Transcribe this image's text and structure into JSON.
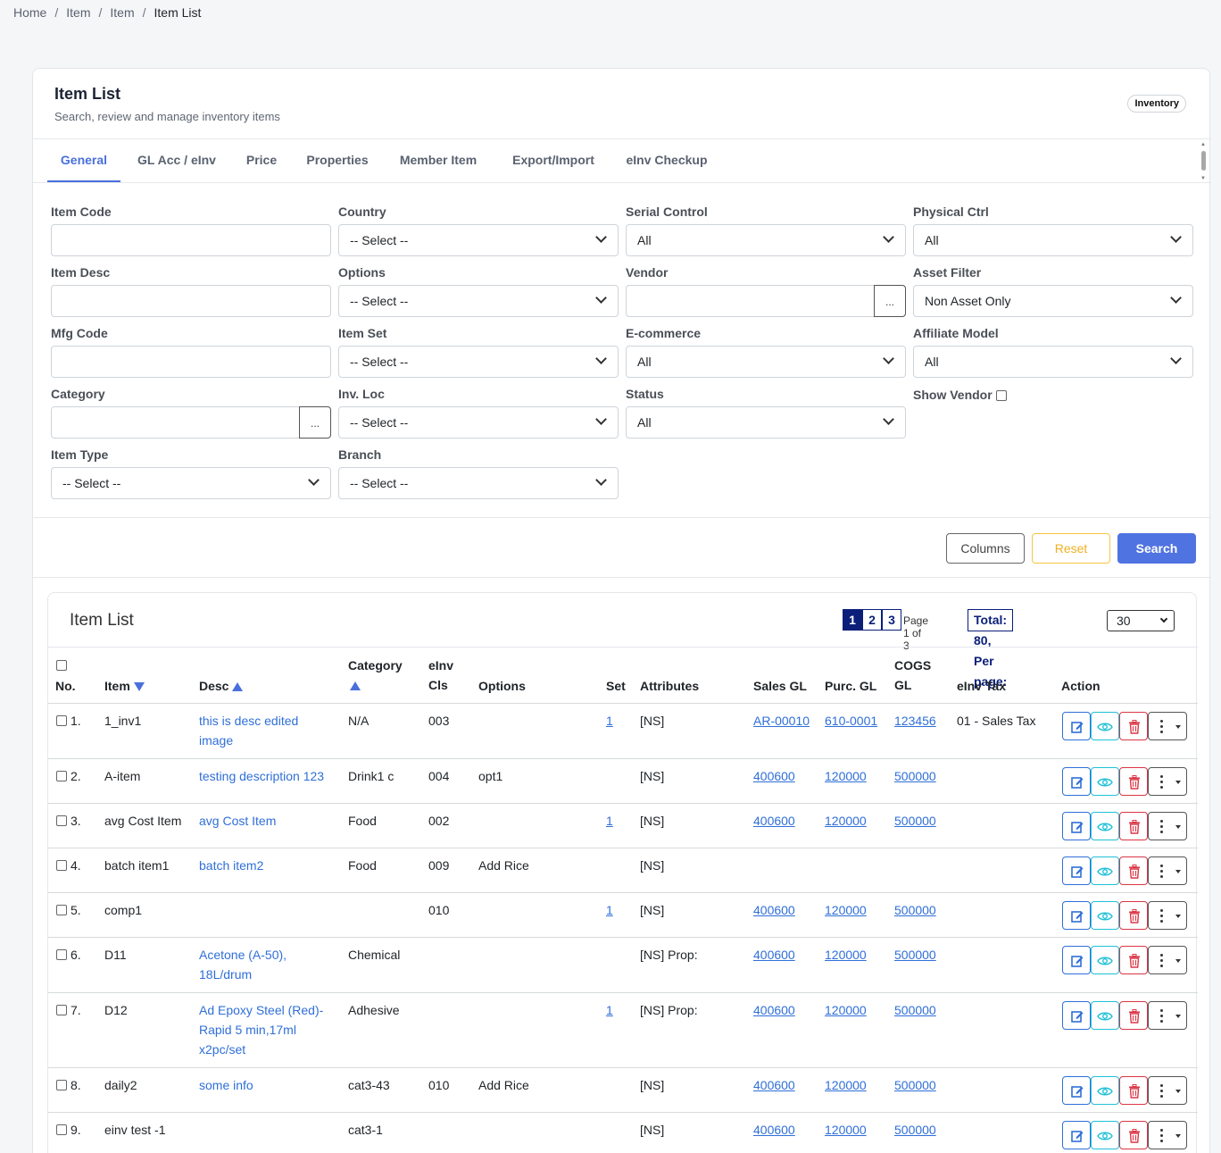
{
  "breadcrumb": [
    "Home",
    "Item",
    "Item",
    "Item List"
  ],
  "header": {
    "title": "Item List",
    "subtitle": "Search, review and manage inventory items",
    "badge": "Inventory"
  },
  "tabs": [
    "General",
    "GL Acc / eInv",
    "Price",
    "Properties",
    "Member Item",
    "Export/Import",
    "eInv Checkup"
  ],
  "active_tab": "General",
  "filters": {
    "item_code": {
      "label": "Item Code",
      "value": ""
    },
    "item_desc": {
      "label": "Item Desc",
      "value": ""
    },
    "mfg_code": {
      "label": "Mfg Code",
      "value": ""
    },
    "category": {
      "label": "Category",
      "value": "",
      "button": "..."
    },
    "item_type": {
      "label": "Item Type",
      "value": "-- Select --"
    },
    "country": {
      "label": "Country",
      "value": "-- Select --"
    },
    "options": {
      "label": "Options",
      "value": "-- Select --"
    },
    "item_set": {
      "label": "Item Set",
      "value": "-- Select --"
    },
    "inv_loc": {
      "label": "Inv. Loc",
      "value": "-- Select --"
    },
    "branch": {
      "label": "Branch",
      "value": "-- Select --"
    },
    "serial_control": {
      "label": "Serial Control",
      "value": "All"
    },
    "vendor": {
      "label": "Vendor",
      "value": "",
      "button": "..."
    },
    "ecommerce": {
      "label": "E-commerce",
      "value": "All"
    },
    "status": {
      "label": "Status",
      "value": "All"
    },
    "physical_ctrl": {
      "label": "Physical Ctrl",
      "value": "All"
    },
    "asset_filter": {
      "label": "Asset Filter",
      "value": "Non Asset Only"
    },
    "affiliate_model": {
      "label": "Affiliate Model",
      "value": "All"
    },
    "show_vendor": {
      "label": "Show Vendor",
      "checked": false
    }
  },
  "buttons": {
    "columns": "Columns",
    "reset": "Reset",
    "search": "Search"
  },
  "list": {
    "title": "Item List",
    "pages": [
      "1",
      "2",
      "3"
    ],
    "active_page": "1",
    "page_info": "Page 1 of 3",
    "total_label": "Total: 80, Per page:",
    "per_page": "30"
  },
  "columns": {
    "no": "No.",
    "item": "Item",
    "desc": "Desc",
    "category": "Category",
    "einv_cls_1": "eInv",
    "einv_cls_2": "Cls",
    "options": "Options",
    "set": "Set",
    "attributes": "Attributes",
    "sales_gl": "Sales GL",
    "purc_gl": "Purc. GL",
    "cogs_gl_1": "COGS",
    "cogs_gl_2": "GL",
    "einv_tax": "eInv Tax",
    "action": "Action"
  },
  "rows": [
    {
      "no": "1.",
      "item": "1_inv1",
      "desc": [
        "this is desc edited",
        "image"
      ],
      "category": "N/A",
      "einv_cls": "003",
      "options": "",
      "set": "1",
      "attributes": "[NS]",
      "sales_gl": "AR-00010",
      "purc_gl": "610-0001",
      "cogs_gl": "123456",
      "einv_tax": "01 - Sales Tax"
    },
    {
      "no": "2.",
      "item": "A-item",
      "desc": [
        "testing description 123"
      ],
      "category": "Drink1 c",
      "einv_cls": "004",
      "options": "opt1",
      "set": "",
      "attributes": "[NS]",
      "sales_gl": "400600",
      "purc_gl": "120000",
      "cogs_gl": "500000",
      "einv_tax": ""
    },
    {
      "no": "3.",
      "item": "avg Cost Item",
      "desc": [
        "avg Cost Item"
      ],
      "category": "Food",
      "einv_cls": "002",
      "options": "",
      "set": "1",
      "attributes": "[NS]",
      "sales_gl": "400600",
      "purc_gl": "120000",
      "cogs_gl": "500000",
      "einv_tax": ""
    },
    {
      "no": "4.",
      "item": "batch item1",
      "desc": [
        "batch item2"
      ],
      "category": "Food",
      "einv_cls": "009",
      "options": "Add Rice",
      "set": "",
      "attributes": "[NS]",
      "sales_gl": "",
      "purc_gl": "",
      "cogs_gl": "",
      "einv_tax": ""
    },
    {
      "no": "5.",
      "item": "comp1",
      "desc": [
        ""
      ],
      "category": "",
      "einv_cls": "010",
      "options": "",
      "set": "1",
      "attributes": "[NS]",
      "sales_gl": "400600",
      "purc_gl": "120000",
      "cogs_gl": "500000",
      "einv_tax": ""
    },
    {
      "no": "6.",
      "item": "D11",
      "desc": [
        "Acetone (A-50),",
        "18L/drum"
      ],
      "category": "Chemical",
      "einv_cls": "",
      "options": "",
      "set": "",
      "attributes": "[NS] Prop:",
      "sales_gl": "400600",
      "purc_gl": "120000",
      "cogs_gl": "500000",
      "einv_tax": ""
    },
    {
      "no": "7.",
      "item": "D12",
      "desc": [
        "Ad Epoxy Steel (Red)-",
        "Rapid 5 min,17ml",
        "x2pc/set"
      ],
      "category": "Adhesive",
      "einv_cls": "",
      "options": "",
      "set": "1",
      "attributes": "[NS] Prop:",
      "sales_gl": "400600",
      "purc_gl": "120000",
      "cogs_gl": "500000",
      "einv_tax": ""
    },
    {
      "no": "8.",
      "item": "daily2",
      "desc": [
        "some info"
      ],
      "category": "cat3-43",
      "einv_cls": "010",
      "options": "Add Rice",
      "set": "",
      "attributes": "[NS]",
      "sales_gl": "400600",
      "purc_gl": "120000",
      "cogs_gl": "500000",
      "einv_tax": ""
    },
    {
      "no": "9.",
      "item": "einv test -1",
      "desc": [
        ""
      ],
      "category": "cat3-1",
      "einv_cls": "",
      "options": "",
      "set": "",
      "attributes": "[NS]",
      "sales_gl": "400600",
      "purc_gl": "120000",
      "cogs_gl": "500000",
      "einv_tax": ""
    }
  ],
  "icons": {
    "edit": "edit-icon",
    "view": "eye-icon",
    "delete": "trash-icon",
    "more": "kebab-menu-icon"
  },
  "colors": {
    "primary": "#4f73e0",
    "link": "#2f6fd8",
    "pager": "#0a1e7a",
    "reset": "#f0b020",
    "delete": "#dc3545",
    "view": "#20c0d8"
  }
}
